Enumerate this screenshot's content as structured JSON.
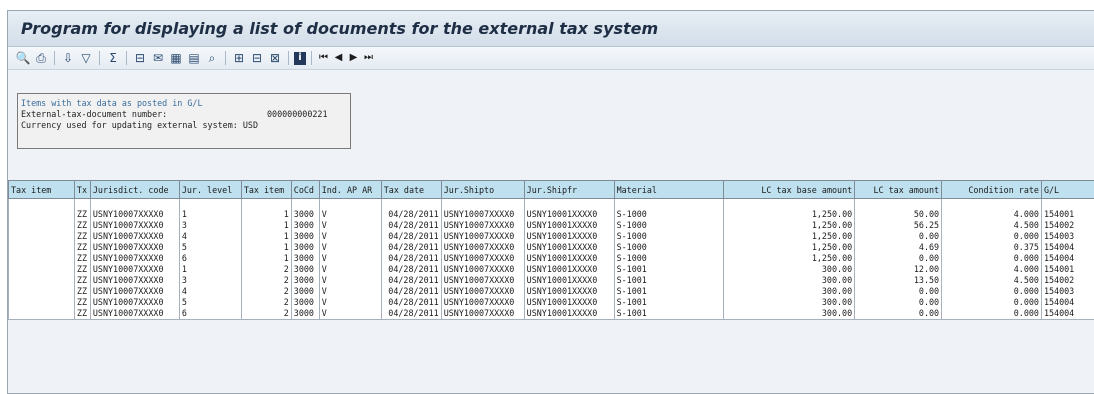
{
  "window": {
    "title": "Program for displaying a list of documents for the external tax system"
  },
  "toolbar": {
    "buttons": [
      {
        "name": "details-icon",
        "glyph": "🔍"
      },
      {
        "name": "print-icon",
        "glyph": "⎙"
      },
      {
        "name": "sort-ascending-icon",
        "glyph": "⇩"
      },
      {
        "name": "filter-icon",
        "glyph": "▽"
      },
      {
        "name": "total-icon",
        "glyph": "Σ"
      },
      {
        "name": "export-icon",
        "glyph": "⊟"
      },
      {
        "name": "mail-icon",
        "glyph": "✉"
      },
      {
        "name": "spreadsheet-icon",
        "glyph": "▦"
      },
      {
        "name": "layout-icon",
        "glyph": "▤"
      },
      {
        "name": "find-icon",
        "glyph": "⌕"
      },
      {
        "name": "choose-layout-icon",
        "glyph": "⊞"
      },
      {
        "name": "change-layout-icon",
        "glyph": "⊟"
      },
      {
        "name": "save-layout-icon",
        "glyph": "⊠"
      },
      {
        "name": "information-icon",
        "glyph": "i"
      },
      {
        "name": "first-page-icon",
        "glyph": "⏮"
      },
      {
        "name": "previous-page-icon",
        "glyph": "◀"
      },
      {
        "name": "next-page-icon",
        "glyph": "▶"
      },
      {
        "name": "last-page-icon",
        "glyph": "⏭"
      }
    ]
  },
  "info": {
    "heading": "Items with tax data as posted in G/L",
    "doc_label": "External-tax-document number:",
    "doc_value": "000000000221",
    "currency_line": "Currency used for updating external system: USD"
  },
  "table": {
    "headers": [
      "Tax item",
      "Tx",
      "Jurisdict. code",
      "Jur. level",
      "Tax item",
      "CoCd",
      "Ind. AP AR",
      "Tax date",
      "Jur.Shipto",
      "Jur.Shipfr",
      "Material",
      "LC tax base amount",
      "LC tax amount",
      "Condition rate",
      "G/L"
    ],
    "rows": [
      [
        "",
        "ZZ",
        "USNY10007XXXX0",
        "1",
        "1",
        "3000",
        "V",
        "04/28/2011",
        "USNY10007XXXX0",
        "USNY10001XXXX0",
        "S-1000",
        "1,250.00",
        "50.00",
        "4.000",
        "154001"
      ],
      [
        "",
        "ZZ",
        "USNY10007XXXX0",
        "3",
        "1",
        "3000",
        "V",
        "04/28/2011",
        "USNY10007XXXX0",
        "USNY10001XXXX0",
        "S-1000",
        "1,250.00",
        "56.25",
        "4.500",
        "154002"
      ],
      [
        "",
        "ZZ",
        "USNY10007XXXX0",
        "4",
        "1",
        "3000",
        "V",
        "04/28/2011",
        "USNY10007XXXX0",
        "USNY10001XXXX0",
        "S-1000",
        "1,250.00",
        "0.00",
        "0.000",
        "154003"
      ],
      [
        "",
        "ZZ",
        "USNY10007XXXX0",
        "5",
        "1",
        "3000",
        "V",
        "04/28/2011",
        "USNY10007XXXX0",
        "USNY10001XXXX0",
        "S-1000",
        "1,250.00",
        "4.69",
        "0.375",
        "154004"
      ],
      [
        "",
        "ZZ",
        "USNY10007XXXX0",
        "6",
        "1",
        "3000",
        "V",
        "04/28/2011",
        "USNY10007XXXX0",
        "USNY10001XXXX0",
        "S-1000",
        "1,250.00",
        "0.00",
        "0.000",
        "154004"
      ],
      [
        "",
        "ZZ",
        "USNY10007XXXX0",
        "1",
        "2",
        "3000",
        "V",
        "04/28/2011",
        "USNY10007XXXX0",
        "USNY10001XXXX0",
        "S-1001",
        "300.00",
        "12.00",
        "4.000",
        "154001"
      ],
      [
        "",
        "ZZ",
        "USNY10007XXXX0",
        "3",
        "2",
        "3000",
        "V",
        "04/28/2011",
        "USNY10007XXXX0",
        "USNY10001XXXX0",
        "S-1001",
        "300.00",
        "13.50",
        "4.500",
        "154002"
      ],
      [
        "",
        "ZZ",
        "USNY10007XXXX0",
        "4",
        "2",
        "3000",
        "V",
        "04/28/2011",
        "USNY10007XXXX0",
        "USNY10001XXXX0",
        "S-1001",
        "300.00",
        "0.00",
        "0.000",
        "154003"
      ],
      [
        "",
        "ZZ",
        "USNY10007XXXX0",
        "5",
        "2",
        "3000",
        "V",
        "04/28/2011",
        "USNY10007XXXX0",
        "USNY10001XXXX0",
        "S-1001",
        "300.00",
        "0.00",
        "0.000",
        "154004"
      ],
      [
        "",
        "ZZ",
        "USNY10007XXXX0",
        "6",
        "2",
        "3000",
        "V",
        "04/28/2011",
        "USNY10007XXXX0",
        "USNY10001XXXX0",
        "S-1001",
        "300.00",
        "0.00",
        "0.000",
        "154004"
      ]
    ]
  }
}
